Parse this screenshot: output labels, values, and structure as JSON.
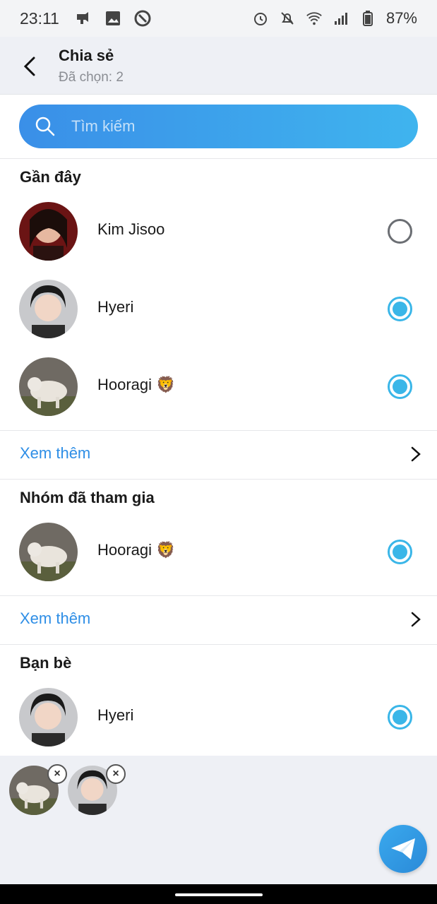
{
  "status_bar": {
    "time": "23:11",
    "battery": "87%"
  },
  "header": {
    "title": "Chia sẻ",
    "subtitle": "Đã chọn: 2"
  },
  "search": {
    "placeholder": "Tìm kiếm"
  },
  "sections": {
    "recent": {
      "title": "Gần đây",
      "items": [
        {
          "name": "Kim Jisoo",
          "selected": false
        },
        {
          "name": "Hyeri",
          "selected": true
        },
        {
          "name": "Hooragi 🦁",
          "selected": true
        }
      ],
      "see_more": "Xem thêm"
    },
    "groups": {
      "title": "Nhóm đã tham gia",
      "items": [
        {
          "name": "Hooragi 🦁",
          "selected": true
        }
      ],
      "see_more": "Xem thêm"
    },
    "friends": {
      "title": "Bạn bè",
      "items": [
        {
          "name": "Hyeri",
          "selected": true
        }
      ]
    }
  },
  "selected_tray": {
    "remove_label": "×"
  },
  "colors": {
    "accent": "#3ab6e8",
    "link": "#2e8ee6",
    "search_start": "#3a8fe8",
    "search_end": "#3fb4ee"
  }
}
